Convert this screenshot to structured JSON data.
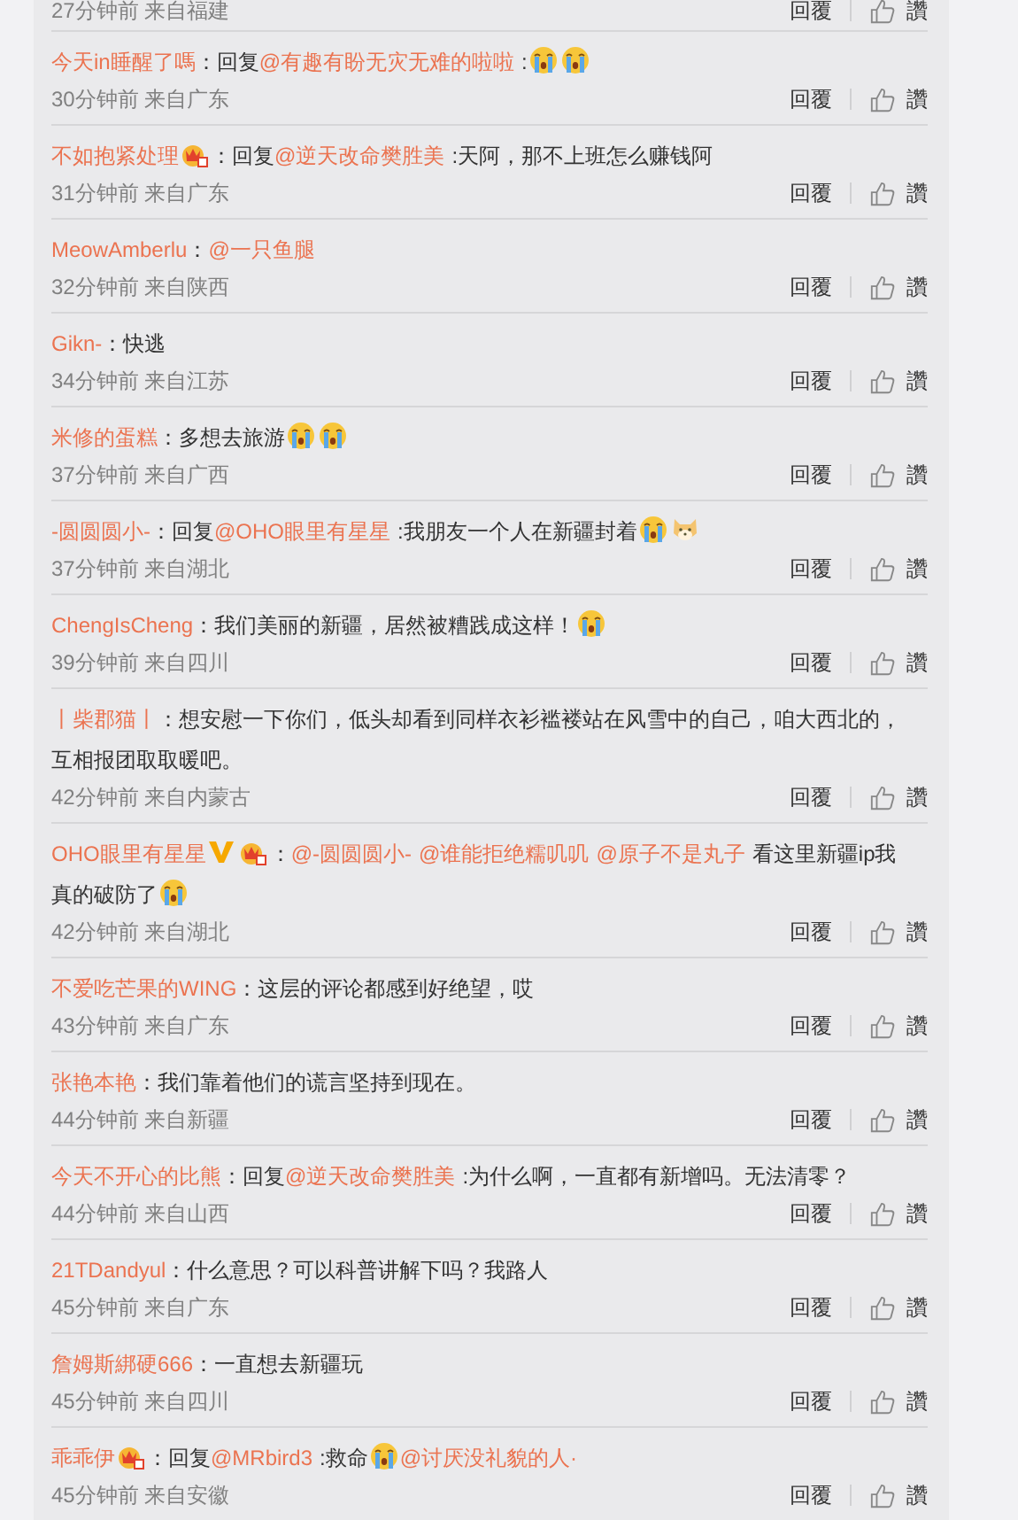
{
  "top_row": {
    "meta": "27分钟前 来自福建",
    "reply": "回覆",
    "like": "讚"
  },
  "comments": [
    {
      "parts": [
        {
          "kind": "name",
          "text": "今天in睡醒了嗎"
        },
        {
          "kind": "text",
          "text": "：回复"
        },
        {
          "kind": "mention",
          "text": "@有趣有盼无灾无难的啦啦"
        },
        {
          "kind": "text",
          "text": ":"
        },
        {
          "kind": "cry"
        },
        {
          "kind": "cry"
        }
      ],
      "meta": "30分钟前 来自广东",
      "reply": "回覆",
      "like": "讚"
    },
    {
      "parts": [
        {
          "kind": "name",
          "text": "不如抱紧处理"
        },
        {
          "kind": "crown"
        },
        {
          "kind": "text",
          "text": "：回复"
        },
        {
          "kind": "mention",
          "text": "@逆天改命樊胜美"
        },
        {
          "kind": "text",
          "text": ":天阿，那不上班怎么赚钱阿"
        }
      ],
      "meta": "31分钟前 来自广东",
      "reply": "回覆",
      "like": "讚"
    },
    {
      "parts": [
        {
          "kind": "name",
          "text": "MeowAmberlu"
        },
        {
          "kind": "text",
          "text": "："
        },
        {
          "kind": "mention",
          "text": "@一只鱼腿"
        }
      ],
      "meta": "32分钟前 来自陕西",
      "reply": "回覆",
      "like": "讚"
    },
    {
      "parts": [
        {
          "kind": "name",
          "text": "Gikn-"
        },
        {
          "kind": "text",
          "text": "：快逃"
        }
      ],
      "meta": "34分钟前 来自江苏",
      "reply": "回覆",
      "like": "讚"
    },
    {
      "parts": [
        {
          "kind": "name",
          "text": "米修的蛋糕"
        },
        {
          "kind": "text",
          "text": "：多想去旅游"
        },
        {
          "kind": "cry"
        },
        {
          "kind": "cry"
        }
      ],
      "meta": "37分钟前 来自广西",
      "reply": "回覆",
      "like": "讚"
    },
    {
      "parts": [
        {
          "kind": "name",
          "text": "-圆圆圆小-"
        },
        {
          "kind": "text",
          "text": "：回复"
        },
        {
          "kind": "mention",
          "text": "@OHO眼里有星星"
        },
        {
          "kind": "text",
          "text": ":我朋友一个人在新疆封着"
        },
        {
          "kind": "cry"
        },
        {
          "kind": "dog"
        }
      ],
      "meta": "37分钟前 来自湖北",
      "reply": "回覆",
      "like": "讚"
    },
    {
      "parts": [
        {
          "kind": "name",
          "text": "ChengIsCheng"
        },
        {
          "kind": "text",
          "text": "：我们美丽的新疆，居然被糟践成这样！"
        },
        {
          "kind": "cry"
        }
      ],
      "meta": "39分钟前 来自四川",
      "reply": "回覆",
      "like": "讚"
    },
    {
      "parts": [
        {
          "kind": "name",
          "text": "丨柴郡猫丨"
        },
        {
          "kind": "text",
          "text": "：想安慰一下你们，低头却看到同样衣衫褴褛站在风雪中的自己，咱大西北的，互相报团取取暖吧。"
        }
      ],
      "meta": "42分钟前 来自内蒙古",
      "reply": "回覆",
      "like": "讚"
    },
    {
      "parts": [
        {
          "kind": "name",
          "text": "OHO眼里有星星"
        },
        {
          "kind": "vip"
        },
        {
          "kind": "crown"
        },
        {
          "kind": "text",
          "text": "："
        },
        {
          "kind": "mention",
          "text": "@-圆圆圆小-"
        },
        {
          "kind": "mention",
          "text": "@谁能拒绝糯叽叽"
        },
        {
          "kind": "mention",
          "text": "@原子不是丸子"
        },
        {
          "kind": "text",
          "text": "看这里新疆ip我真的破防了"
        },
        {
          "kind": "cry"
        }
      ],
      "meta": "42分钟前 来自湖北",
      "reply": "回覆",
      "like": "讚"
    },
    {
      "parts": [
        {
          "kind": "name",
          "text": "不爱吃芒果的WING"
        },
        {
          "kind": "text",
          "text": "：这层的评论都感到好绝望，哎"
        }
      ],
      "meta": "43分钟前 来自广东",
      "reply": "回覆",
      "like": "讚"
    },
    {
      "parts": [
        {
          "kind": "name",
          "text": "张艳本艳"
        },
        {
          "kind": "text",
          "text": "：我们靠着他们的谎言坚持到现在。"
        }
      ],
      "meta": "44分钟前 来自新疆",
      "reply": "回覆",
      "like": "讚"
    },
    {
      "parts": [
        {
          "kind": "name",
          "text": "今天不开心的比熊"
        },
        {
          "kind": "text",
          "text": "：回复"
        },
        {
          "kind": "mention",
          "text": "@逆天改命樊胜美"
        },
        {
          "kind": "text",
          "text": ":为什么啊，一直都有新增吗。无法清零？"
        }
      ],
      "meta": "44分钟前 来自山西",
      "reply": "回覆",
      "like": "讚"
    },
    {
      "parts": [
        {
          "kind": "name",
          "text": "21TDandyul"
        },
        {
          "kind": "text",
          "text": "：什么意思？可以科普讲解下吗？我路人"
        }
      ],
      "meta": "45分钟前 来自广东",
      "reply": "回覆",
      "like": "讚"
    },
    {
      "parts": [
        {
          "kind": "name",
          "text": "詹姆斯綁硬666"
        },
        {
          "kind": "text",
          "text": "：一直想去新疆玩"
        }
      ],
      "meta": "45分钟前 来自四川",
      "reply": "回覆",
      "like": "讚"
    },
    {
      "parts": [
        {
          "kind": "name",
          "text": "乖乖伊"
        },
        {
          "kind": "crown"
        },
        {
          "kind": "text",
          "text": "：回复"
        },
        {
          "kind": "mention",
          "text": "@MRbird3"
        },
        {
          "kind": "text",
          "text": ":救命"
        },
        {
          "kind": "cry"
        },
        {
          "kind": "mention",
          "text": "@讨厌没礼貌的人·"
        }
      ],
      "meta": "45分钟前 来自安徽",
      "reply": "回覆",
      "like": "讚"
    }
  ]
}
